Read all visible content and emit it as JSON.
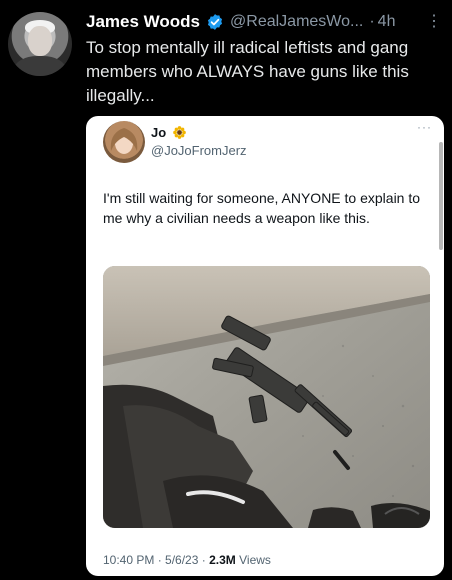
{
  "tweet": {
    "author_name": "James Woods",
    "author_handle": "@RealJamesWo...",
    "separator": "·",
    "time_ago": "4h",
    "text": "To stop mentally ill radical leftists and gang members who ALWAYS have guns like this illegally...",
    "more_icon": "vertical-ellipsis-icon",
    "verified_icon": "verified-badge-icon",
    "colors": {
      "background": "#000000",
      "verified": "#1d9bf0",
      "secondary_text": "#8b98a5"
    }
  },
  "quoted_tweet": {
    "author_name": "Jo",
    "author_handle": "@JoJoFromJerz",
    "text": "I'm still waiting for someone, ANYONE to explain to me why a civilian needs a weapon like this.",
    "more_icon": "horizontal-ellipsis-icon",
    "emoji_icon": "sunflower-icon",
    "timestamp": "10:40 PM · 5/6/23 ·",
    "views_count": "2.3M",
    "views_label": "Views"
  }
}
